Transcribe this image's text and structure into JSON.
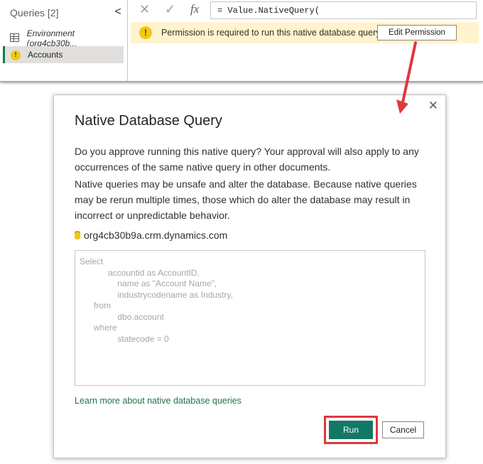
{
  "queries_pane": {
    "title": "Queries [2]",
    "collapse_glyph": "<",
    "items": [
      {
        "label": "Environment (org4cb30b...",
        "icon": "table-icon"
      },
      {
        "label": "Accounts",
        "icon": "warning-icon",
        "selected": true
      }
    ]
  },
  "formula_bar": {
    "cancel_glyph": "✕",
    "commit_glyph": "✓",
    "fx_label": "fx",
    "formula": "= Value.NativeQuery("
  },
  "permission_bar": {
    "message": "Permission is required to run this native database query.",
    "button_label": "Edit Permission",
    "color": "#fff4ce"
  },
  "dialog": {
    "title": "Native Database Query",
    "close_glyph": "✕",
    "paragraph1": "Do you approve running this native query? Your approval will also apply to any occurrences of the same native query in other documents.",
    "paragraph2": "Native queries may be unsafe and alter the database. Because native queries may be rerun multiple times, those which do alter the database may result in incorrect or unpredictable behavior.",
    "server": "org4cb30b9a.crm.dynamics.com",
    "query_lines": [
      "Select",
      "            accountid as AccountID,",
      "                name as \"Account Name\",",
      "                industrycodename as Industry,",
      "      from",
      "                dbo.account",
      "      where",
      "                statecode = 0"
    ],
    "learn_more": "Learn more about native database queries",
    "run_label": "Run",
    "cancel_label": "Cancel"
  },
  "colors": {
    "accent": "#117865",
    "annotation": "#e0373e",
    "warning": "#f2c811"
  }
}
